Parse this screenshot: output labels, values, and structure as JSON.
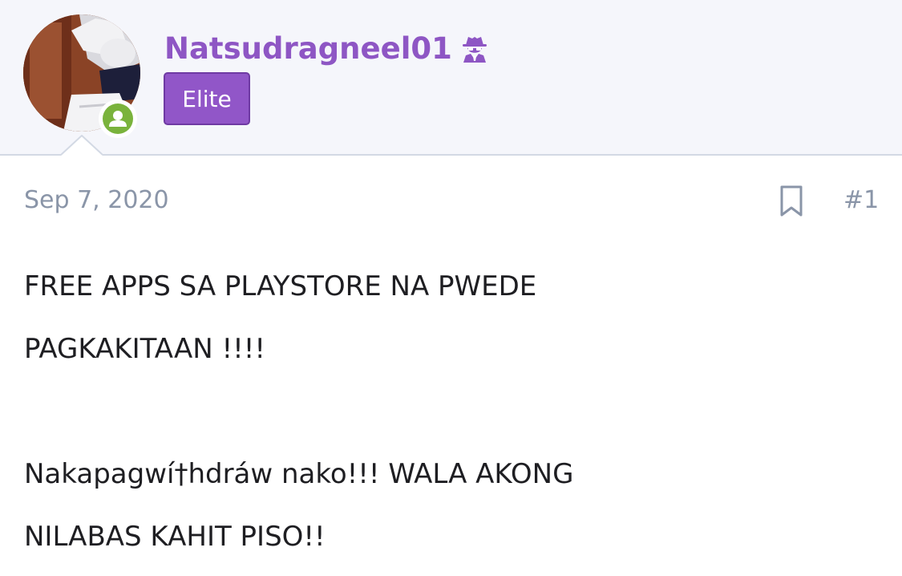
{
  "user": {
    "username": "Natsudragneel01",
    "badge": "Elite",
    "username_color": "#8e56c4",
    "badge_color": "#9156c8",
    "online_status_color": "#7ab33c",
    "title_icon": "user-secret-icon"
  },
  "post": {
    "date": "Sep 7, 2020",
    "number": "#1",
    "bookmark_icon": "bookmark-icon",
    "body_lines": [
      "FREE APPS SA PLAYSTORE NA PWEDE",
      "PAGKAKITAAN !!!!",
      "",
      "Nakapagwí†hdráw nako!!! WALA AKONG",
      "NILABAS KAHIT PISO!!"
    ]
  }
}
